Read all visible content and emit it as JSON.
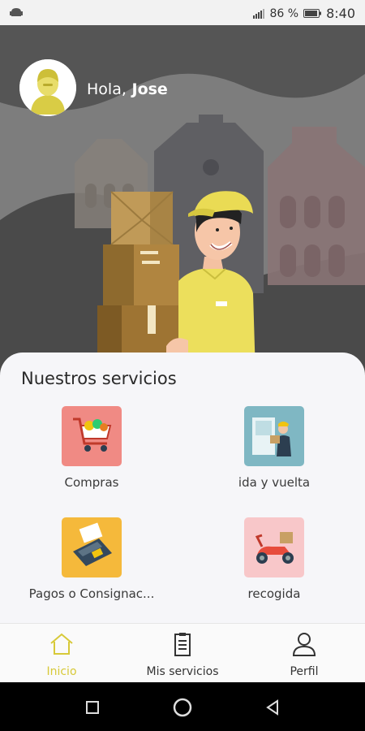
{
  "status_bar": {
    "battery_percent": "86 %",
    "time": "8:40"
  },
  "header": {
    "greeting_prefix": "Hola,",
    "user_name": "Jose"
  },
  "services": {
    "title": "Nuestros servicios",
    "items": [
      {
        "label": "Compras",
        "icon": "shopping-cart-icon",
        "tile_color": "#f08a84"
      },
      {
        "label": "ida y vuelta",
        "icon": "delivery-handoff-icon",
        "tile_color": "#7fb7c3"
      },
      {
        "label": "Pagos o Consignac...",
        "icon": "payment-terminal-icon",
        "tile_color": "#f5b93b"
      },
      {
        "label": "recogida",
        "icon": "scooter-icon",
        "tile_color": "#f8c7c9"
      }
    ]
  },
  "bottom_nav": {
    "items": [
      {
        "label": "Inicio",
        "icon": "home-icon",
        "active": true
      },
      {
        "label": "Mis servicios",
        "icon": "clipboard-icon",
        "active": false
      },
      {
        "label": "Perfil",
        "icon": "user-icon",
        "active": false
      }
    ]
  },
  "colors": {
    "accent": "#d7c938",
    "hero_bg": "#7b7b7b",
    "card_bg": "#f6f6f9"
  }
}
